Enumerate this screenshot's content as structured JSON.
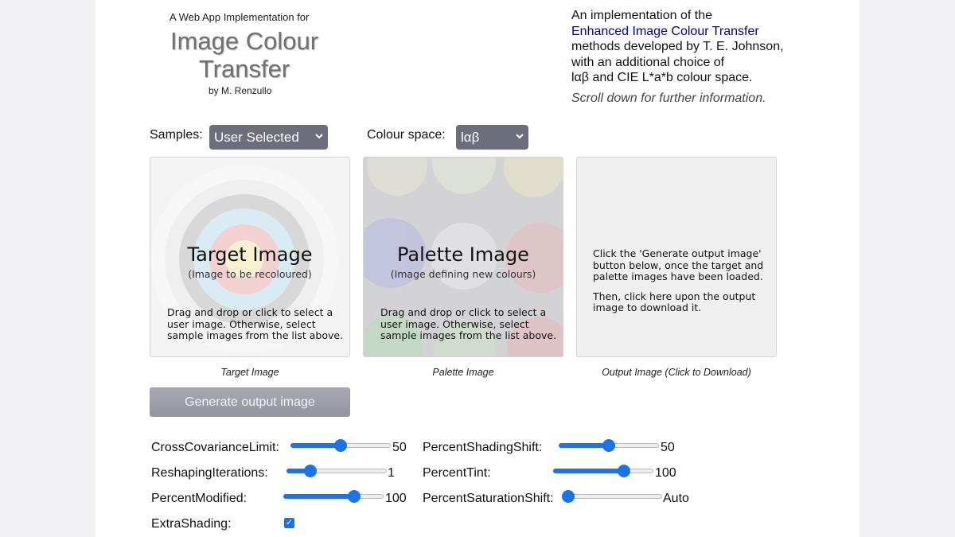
{
  "header": {
    "subtitle": "A Web App Implementation for",
    "title_line1": "Image Colour",
    "title_line2": "Transfer",
    "byline": "by M. Renzullo"
  },
  "description": {
    "line1": "An implementation of the",
    "link": "Enhanced Image Colour Transfer",
    "line3": "methods developed by T. E. Johnson,",
    "line4": "with an additional choice of",
    "line5": "lαβ and CIE L*a*b colour space.",
    "scroll_note": "Scroll down for further information."
  },
  "samples": {
    "label": "Samples:",
    "value": "User Selected"
  },
  "colour_space": {
    "label": "Colour space:",
    "value": "lαβ"
  },
  "target_panel": {
    "title": "Target Image",
    "subtitle": "(Image to be recoloured)",
    "help1": "Drag and drop or click to select a",
    "help2": "user image.  Otherwise, select",
    "help3": "sample images from the list above.",
    "caption": "Target Image"
  },
  "palette_panel": {
    "title": "Palette Image",
    "subtitle": "(Image defining new colours)",
    "help1": "Drag and drop or click to select a",
    "help2": "user image.  Otherwise, select",
    "help3": "sample images from the list above.",
    "caption": "Palette Image"
  },
  "output_panel": {
    "text1": "Click the 'Generate output image'",
    "text2": "button below, once the target and",
    "text3": "palette images have been loaded.",
    "text4": "Then, click here upon the output",
    "text5": "image to download it.",
    "caption": "Output Image (Click to Download)"
  },
  "generate_button": "Generate output image",
  "params": {
    "cross_covariance_limit": {
      "label": "CrossCovarianceLimit:",
      "value": "50",
      "fraction": 0.5
    },
    "reshaping_iterations": {
      "label": "ReshapingIterations:",
      "value": "1",
      "fraction": 0.2
    },
    "percent_modified": {
      "label": "PercentModified:",
      "value": "100",
      "fraction": 0.74
    },
    "percent_shading_shift": {
      "label": "PercentShadingShift:",
      "value": "50",
      "fraction": 0.5
    },
    "percent_tint": {
      "label": "PercentTint:",
      "value": "100",
      "fraction": 0.74
    },
    "percent_saturation_shift": {
      "label": "PercentSaturationShift:",
      "value": "Auto",
      "fraction": 0.0
    },
    "extra_shading": {
      "label": "ExtraShading:",
      "checked": true
    }
  },
  "colors": {
    "accent": "#1a73e8",
    "select_bg": "#6c6e7e",
    "link": "#00008b"
  }
}
